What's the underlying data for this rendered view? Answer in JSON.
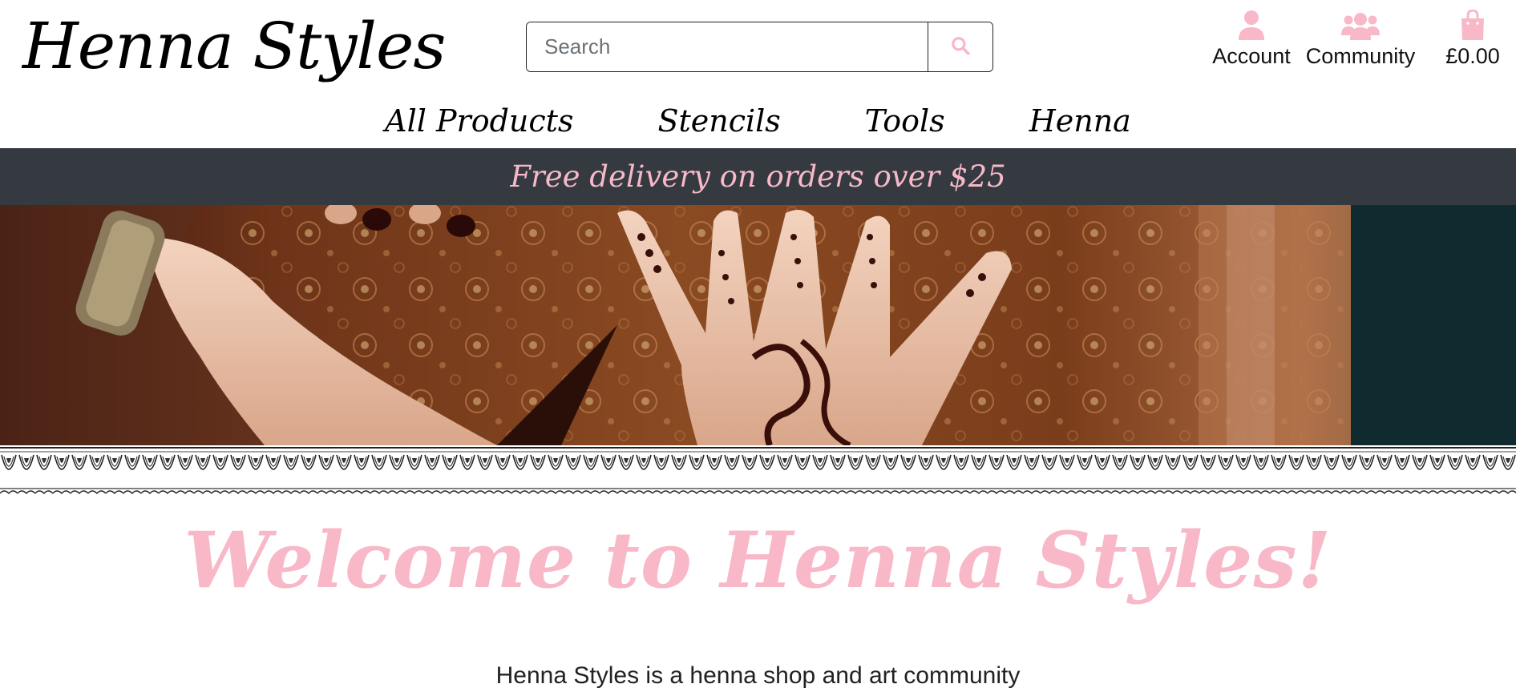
{
  "header": {
    "logo": "Henna Styles",
    "search": {
      "placeholder": "Search",
      "value": "",
      "button_icon": "search-icon"
    },
    "links": {
      "account": {
        "label": "Account",
        "icon": "user-icon"
      },
      "community": {
        "label": "Community",
        "icon": "users-icon"
      },
      "bag": {
        "label": "£0.00",
        "icon": "shopping-bag-icon"
      }
    }
  },
  "nav": {
    "items": [
      {
        "label": "All Products"
      },
      {
        "label": "Stencils"
      },
      {
        "label": "Tools"
      },
      {
        "label": "Henna"
      }
    ]
  },
  "banner": {
    "text": "Free delivery on orders over $25"
  },
  "welcome": {
    "heading": "Welcome to Henna Styles!",
    "intro": "Henna Styles is a henna shop and art community"
  },
  "colors": {
    "accent_pink": "#f8b8c8",
    "banner_bg": "#343a40",
    "text": "#111111"
  }
}
